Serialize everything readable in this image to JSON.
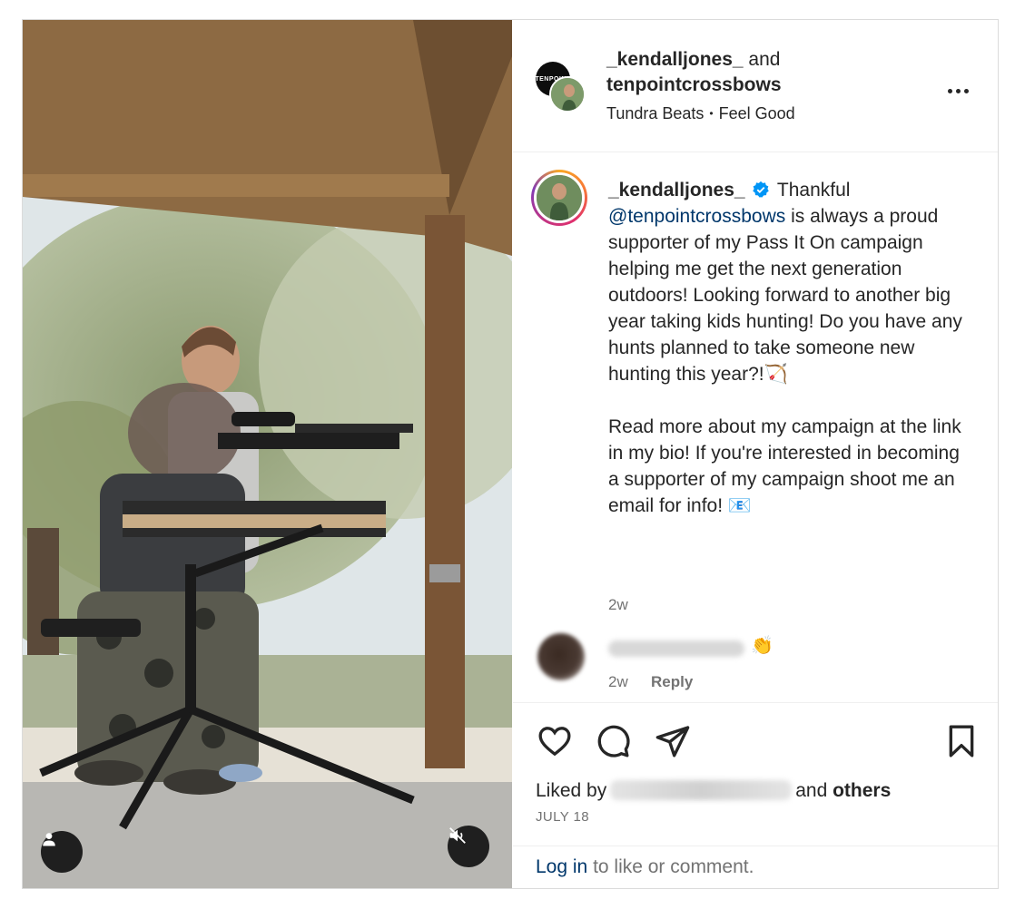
{
  "header": {
    "user1": "_kendalljones_",
    "and_word": "and",
    "user2": "tenpointcrossbows",
    "brand_avatar_text": "TENPOINT",
    "audio_artist": "Tundra Beats",
    "audio_separator": "•",
    "audio_track": "Feel Good"
  },
  "caption": {
    "username": "_kendalljones_",
    "text_start": "Thankful",
    "mention": "@tenpointcrossbows",
    "text_rest": "is always a proud supporter of my Pass It On campaign helping me get the next generation outdoors! Looking forward to another big year taking kids hunting! Do you have any hunts planned to take someone new hunting this year?!🏹",
    "paragraph2": "Read more about my campaign at the link in my bio! If you're interested in becoming a supporter of my campaign shoot me an email for info! 📧",
    "time": "2w"
  },
  "comment": {
    "emoji": "👏",
    "time": "2w",
    "reply_label": "Reply"
  },
  "likes": {
    "prefix": "Liked by",
    "and_word": "and",
    "others": "others"
  },
  "date": "JULY 18",
  "login": {
    "link": "Log in",
    "rest": "to like or comment."
  },
  "icons": [
    "user-tag-icon",
    "muted-speaker-icon",
    "more-options-icon",
    "verified-badge-icon",
    "heart-icon",
    "comment-icon",
    "share-icon",
    "bookmark-icon"
  ],
  "colors": {
    "link": "#00376b",
    "verified": "#0095f6",
    "secondary_text": "#737373"
  }
}
